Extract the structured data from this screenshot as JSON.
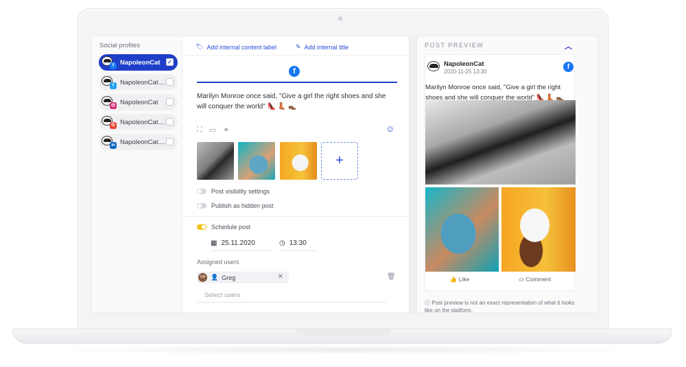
{
  "left": {
    "title": "Social profiles",
    "profiles": [
      {
        "name": "NapoleonCat",
        "network": "facebook",
        "badge": "f",
        "color": "#1877f2",
        "checked": true
      },
      {
        "name": "NapoleonCat....",
        "network": "twitter",
        "badge": "t",
        "color": "#1da1f2",
        "checked": false
      },
      {
        "name": "NapoleonCat",
        "network": "instagram",
        "badge": "◎",
        "color": "#d62976",
        "checked": false
      },
      {
        "name": "NapoleonCat....",
        "network": "google",
        "badge": "G",
        "color": "#ea4335",
        "checked": false
      },
      {
        "name": "NapoleonCat....",
        "network": "linkedin",
        "badge": "in",
        "color": "#0a66c2",
        "checked": false
      }
    ]
  },
  "editor": {
    "label_link": "Add internal content label",
    "title_link": "Add internal title",
    "facebook_glyph": "f",
    "post_text": "Marilyn Monroe once said, \"Give a girl the right shoes and she will conquer the world\" 👠 👢 👞",
    "toggle_visibility": "Post visibility settings",
    "toggle_hidden": "Publish as hidden post",
    "schedule_label": "Schedule post",
    "date": "25.11.2020",
    "time": "13:30",
    "assigned_title": "Assigned users",
    "user_initials": "GB",
    "user_name": "Greg",
    "select_placeholder": "Select users",
    "add_glyph": "+"
  },
  "preview": {
    "title": "POST PREVIEW",
    "account_name": "NapoleonCat",
    "timestamp": "2020-11-25 13:30",
    "text": "Marilyn Monroe once said, \"Give a girl the right shoes and she will conquer the world\" 👠 👢 👞",
    "like": "Like",
    "comment": "Comment",
    "note": "Post preview is not an exact representation of what it looks like on the platform."
  },
  "colors": {
    "accent": "#1f3fc9",
    "facebook": "#1877f2",
    "toggle_on": "#f2c21a"
  }
}
